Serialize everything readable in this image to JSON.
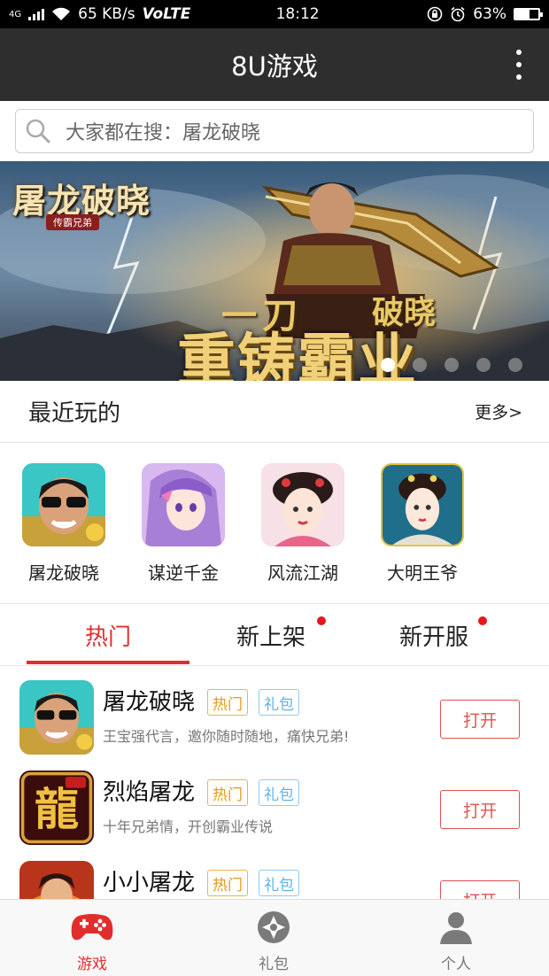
{
  "status_bar": {
    "network_type": "4G",
    "speed": "65 KB/s",
    "volte": "VoLTE",
    "time": "18:12",
    "battery": "63%",
    "battery_level": 0.63
  },
  "app_bar": {
    "title": "8U游戏",
    "menu_icon": "more-vert-icon"
  },
  "search": {
    "placeholder": "大家都在搜：屠龙破晓",
    "icon": "search-icon"
  },
  "banner": {
    "logo_title": "屠龙破晓",
    "logo_subtitle": "传霸兄弟",
    "slogan_left": "一刀",
    "slogan_right": "破晓",
    "slogan_main": "重铸霸业",
    "dot_count": 5,
    "active_dot": 0
  },
  "recent": {
    "heading": "最近玩的",
    "more_label": "更多>",
    "items": [
      {
        "name": "屠龙破晓"
      },
      {
        "name": "谋逆千金"
      },
      {
        "name": "风流江湖"
      },
      {
        "name": "大明王爷"
      }
    ]
  },
  "tabs": [
    {
      "label": "热门",
      "active": true,
      "has_dot": false
    },
    {
      "label": "新上架",
      "active": false,
      "has_dot": true
    },
    {
      "label": "新开服",
      "active": false,
      "has_dot": true
    }
  ],
  "game_list": [
    {
      "name": "屠龙破晓",
      "tag_hot": "热门",
      "tag_gift": "礼包",
      "desc": "王宝强代言，邀你随时随地，痛快兄弟!",
      "button": "打开"
    },
    {
      "name": "烈焰屠龙",
      "tag_hot": "热门",
      "tag_gift": "礼包",
      "desc": "十年兄弟情，开创霸业传说",
      "button": "打开"
    },
    {
      "name": "小小屠龙",
      "tag_hot": "热门",
      "tag_gift": "礼包",
      "desc": "",
      "button": "打开"
    }
  ],
  "bottom_nav": [
    {
      "label": "游戏",
      "icon": "gamepad-icon",
      "active": true
    },
    {
      "label": "礼包",
      "icon": "gift-icon",
      "active": false
    },
    {
      "label": "个人",
      "icon": "person-icon",
      "active": false
    }
  ],
  "colors": {
    "accent": "#e02e2e",
    "title_bar": "#2e2e2e",
    "tag_hot": "#e49b1b",
    "tag_gift": "#5fb4e6"
  }
}
